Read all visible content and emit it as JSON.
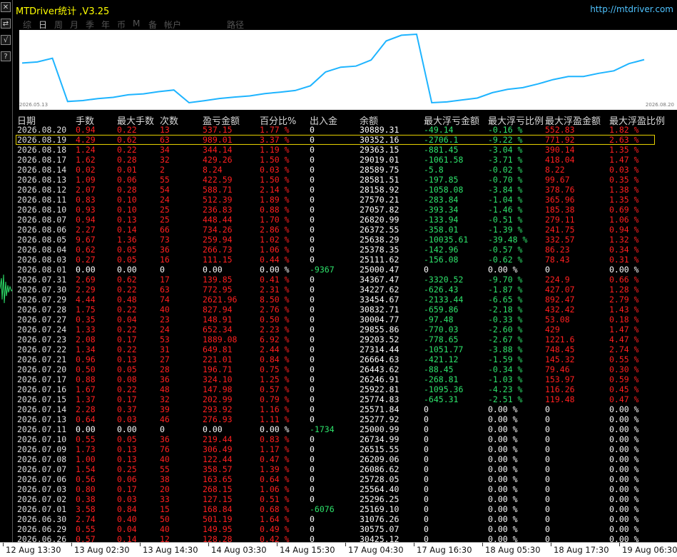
{
  "window": {
    "title": "MTDriver统计 ,V3.25",
    "url": "http://mtdriver.com"
  },
  "tabs": [
    "综",
    "日",
    "周",
    "月",
    "季",
    "年",
    "币",
    "M",
    "备",
    "帐户",
    "",
    "路径"
  ],
  "active_tab": 1,
  "left_buttons": [
    "✕",
    "⇄",
    "√",
    "?"
  ],
  "chart": {
    "start_label": "2026.05.13",
    "end_label": "2026.08.20",
    "line_color": "#1eb4ff"
  },
  "columns": [
    "日期",
    "手数",
    "最大手数",
    "次数",
    "盈亏金额",
    "百分比%",
    "出入金",
    "余额",
    "最大浮亏金额",
    "最大浮亏比例",
    "最大浮盈金额",
    "最大浮盈比例"
  ],
  "rows": [
    [
      "2026.08.20",
      "0.94",
      "0.22",
      "13",
      "537.15",
      "1.77 %",
      "0",
      "30889.31",
      "-49.14",
      "-0.16 %",
      "552.83",
      "1.82 %"
    ],
    [
      "2026.08.19",
      "4.29",
      "0.62",
      "63",
      "989.01",
      "3.37 %",
      "0",
      "30352.16",
      "-2706.1",
      "-9.22 %",
      "771.92",
      "2.63 %"
    ],
    [
      "2026.08.18",
      "1.24",
      "0.22",
      "34",
      "344.14",
      "1.19 %",
      "0",
      "29363.15",
      "-881.45",
      "-3.04 %",
      "390.14",
      "1.35 %"
    ],
    [
      "2026.08.17",
      "1.62",
      "0.28",
      "32",
      "429.26",
      "1.50 %",
      "0",
      "29019.01",
      "-1061.58",
      "-3.71 %",
      "418.04",
      "1.47 %"
    ],
    [
      "2026.08.14",
      "0.02",
      "0.01",
      "2",
      "8.24",
      "0.03 %",
      "0",
      "28589.75",
      "-5.8",
      "-0.02 %",
      "8.22",
      "0.03 %"
    ],
    [
      "2026.08.13",
      "1.09",
      "0.06",
      "55",
      "422.59",
      "1.50 %",
      "0",
      "28581.51",
      "-197.85",
      "-0.70 %",
      "99.67",
      "0.35 %"
    ],
    [
      "2026.08.12",
      "2.07",
      "0.28",
      "54",
      "588.71",
      "2.14 %",
      "0",
      "28158.92",
      "-1058.08",
      "-3.84 %",
      "378.76",
      "1.38 %"
    ],
    [
      "2026.08.11",
      "0.83",
      "0.10",
      "24",
      "512.39",
      "1.89 %",
      "0",
      "27570.21",
      "-283.84",
      "-1.04 %",
      "365.96",
      "1.35 %"
    ],
    [
      "2026.08.10",
      "0.93",
      "0.10",
      "25",
      "236.83",
      "0.88 %",
      "0",
      "27057.82",
      "-393.34",
      "-1.46 %",
      "185.38",
      "0.69 %"
    ],
    [
      "2026.08.07",
      "0.94",
      "0.13",
      "25",
      "448.44",
      "1.70 %",
      "0",
      "26820.99",
      "-133.94",
      "-0.51 %",
      "279.11",
      "1.06 %"
    ],
    [
      "2026.08.06",
      "2.27",
      "0.14",
      "66",
      "734.26",
      "2.86 %",
      "0",
      "26372.55",
      "-358.01",
      "-1.39 %",
      "241.75",
      "0.94 %"
    ],
    [
      "2026.08.05",
      "9.67",
      "1.36",
      "73",
      "259.94",
      "1.02 %",
      "0",
      "25638.29",
      "-10035.61",
      "-39.48 %",
      "332.57",
      "1.32 %"
    ],
    [
      "2026.08.04",
      "0.62",
      "0.05",
      "36",
      "266.73",
      "1.06 %",
      "0",
      "25378.35",
      "-142.96",
      "-0.57 %",
      "86.23",
      "0.34 %"
    ],
    [
      "2026.08.03",
      "0.27",
      "0.05",
      "16",
      "111.15",
      "0.44 %",
      "0",
      "25111.62",
      "-156.08",
      "-0.62 %",
      "78.43",
      "0.31 %"
    ],
    [
      "2026.08.01",
      "0.00",
      "0.00",
      "0",
      "0.00",
      "0.00 %",
      "-9367",
      "25000.47",
      "0",
      "0.00 %",
      "0",
      "0.00 %"
    ],
    [
      "2026.07.31",
      "2.69",
      "0.62",
      "17",
      "139.85",
      "0.41 %",
      "0",
      "34367.47",
      "-3320.52",
      "-9.70 %",
      "224.9",
      "0.66 %"
    ],
    [
      "2026.07.30",
      "2.29",
      "0.22",
      "63",
      "772.95",
      "2.31 %",
      "0",
      "34227.62",
      "-626.43",
      "-1.87 %",
      "427.07",
      "1.28 %"
    ],
    [
      "2026.07.29",
      "4.44",
      "0.48",
      "74",
      "2621.96",
      "8.50 %",
      "0",
      "33454.67",
      "-2133.44",
      "-6.65 %",
      "892.47",
      "2.79 %"
    ],
    [
      "2026.07.28",
      "1.75",
      "0.22",
      "40",
      "827.94",
      "2.76 %",
      "0",
      "30832.71",
      "-659.86",
      "-2.18 %",
      "432.42",
      "1.43 %"
    ],
    [
      "2026.07.27",
      "0.35",
      "0.04",
      "23",
      "148.91",
      "0.50 %",
      "0",
      "30004.77",
      "-97.48",
      "-0.33 %",
      "53.08",
      "0.18 %"
    ],
    [
      "2026.07.24",
      "1.33",
      "0.22",
      "24",
      "652.34",
      "2.23 %",
      "0",
      "29855.86",
      "-770.03",
      "-2.60 %",
      "429",
      "1.47 %"
    ],
    [
      "2026.07.23",
      "2.08",
      "0.17",
      "53",
      "1889.08",
      "6.92 %",
      "0",
      "29203.52",
      "-778.65",
      "-2.67 %",
      "1221.6",
      "4.47 %"
    ],
    [
      "2026.07.22",
      "1.34",
      "0.22",
      "31",
      "649.81",
      "2.44 %",
      "0",
      "27314.44",
      "-1051.77",
      "-3.88 %",
      "748.45",
      "2.74 %"
    ],
    [
      "2026.07.21",
      "0.96",
      "0.13",
      "27",
      "221.01",
      "0.84 %",
      "0",
      "26664.63",
      "-421.12",
      "-1.59 %",
      "145.32",
      "0.55 %"
    ],
    [
      "2026.07.20",
      "0.50",
      "0.05",
      "28",
      "196.71",
      "0.75 %",
      "0",
      "26443.62",
      "-88.45",
      "-0.34 %",
      "79.46",
      "0.30 %"
    ],
    [
      "2026.07.17",
      "0.88",
      "0.08",
      "36",
      "324.10",
      "1.25 %",
      "0",
      "26246.91",
      "-268.81",
      "-1.03 %",
      "153.97",
      "0.59 %"
    ],
    [
      "2026.07.16",
      "1.67",
      "0.22",
      "48",
      "147.98",
      "0.57 %",
      "0",
      "25922.81",
      "-1095.36",
      "-4.23 %",
      "116.26",
      "0.45 %"
    ],
    [
      "2026.07.15",
      "1.37",
      "0.17",
      "32",
      "202.99",
      "0.79 %",
      "0",
      "25774.83",
      "-645.31",
      "-2.51 %",
      "119.48",
      "0.47 %"
    ],
    [
      "2026.07.14",
      "2.28",
      "0.37",
      "39",
      "293.92",
      "1.16 %",
      "0",
      "25571.84",
      "0",
      "0.00 %",
      "0",
      "0.00 %"
    ],
    [
      "2026.07.13",
      "0.64",
      "0.03",
      "46",
      "276.93",
      "1.11 %",
      "0",
      "25277.92",
      "0",
      "0.00 %",
      "0",
      "0.00 %"
    ],
    [
      "2026.07.11",
      "0.00",
      "0.00",
      "0",
      "0.00",
      "0.00 %",
      "-1734",
      "25000.99",
      "0",
      "0.00 %",
      "0",
      "0.00 %"
    ],
    [
      "2026.07.10",
      "0.55",
      "0.05",
      "36",
      "219.44",
      "0.83 %",
      "0",
      "26734.99",
      "0",
      "0.00 %",
      "0",
      "0.00 %"
    ],
    [
      "2026.07.09",
      "1.73",
      "0.13",
      "76",
      "306.49",
      "1.17 %",
      "0",
      "26515.55",
      "0",
      "0.00 %",
      "0",
      "0.00 %"
    ],
    [
      "2026.07.08",
      "1.00",
      "0.13",
      "40",
      "122.44",
      "0.47 %",
      "0",
      "26209.06",
      "0",
      "0.00 %",
      "0",
      "0.00 %"
    ],
    [
      "2026.07.07",
      "1.54",
      "0.25",
      "55",
      "358.57",
      "1.39 %",
      "0",
      "26086.62",
      "0",
      "0.00 %",
      "0",
      "0.00 %"
    ],
    [
      "2026.07.06",
      "0.56",
      "0.06",
      "38",
      "163.65",
      "0.64 %",
      "0",
      "25728.05",
      "0",
      "0.00 %",
      "0",
      "0.00 %"
    ],
    [
      "2026.07.03",
      "0.80",
      "0.17",
      "20",
      "268.15",
      "1.06 %",
      "0",
      "25564.40",
      "0",
      "0.00 %",
      "0",
      "0.00 %"
    ],
    [
      "2026.07.02",
      "0.38",
      "0.03",
      "33",
      "127.15",
      "0.51 %",
      "0",
      "25296.25",
      "0",
      "0.00 %",
      "0",
      "0.00 %"
    ],
    [
      "2026.07.01",
      "3.58",
      "0.84",
      "15",
      "168.84",
      "0.68 %",
      "-6076",
      "25169.10",
      "0",
      "0.00 %",
      "0",
      "0.00 %"
    ],
    [
      "2026.06.30",
      "2.74",
      "0.40",
      "50",
      "501.19",
      "1.64 %",
      "0",
      "31076.26",
      "0",
      "0.00 %",
      "0",
      "0.00 %"
    ],
    [
      "2026.06.29",
      "0.55",
      "0.04",
      "40",
      "149.95",
      "0.49 %",
      "0",
      "30575.07",
      "0",
      "0.00 %",
      "0",
      "0.00 %"
    ],
    [
      "2026.06.26",
      "0.57",
      "0.14",
      "12",
      "128.28",
      "0.42 %",
      "0",
      "30425.12",
      "0",
      "0.00 %",
      "0",
      "0.00 %"
    ]
  ],
  "highlight_row": 1,
  "timeline": [
    "12 Aug 13:30",
    "13 Aug 02:30",
    "13 Aug 14:30",
    "14 Aug 03:30",
    "14 Aug 15:30",
    "17 Aug 04:30",
    "17 Aug 16:30",
    "18 Aug 05:30",
    "18 Aug 17:30",
    "19 Aug 06:30"
  ]
}
